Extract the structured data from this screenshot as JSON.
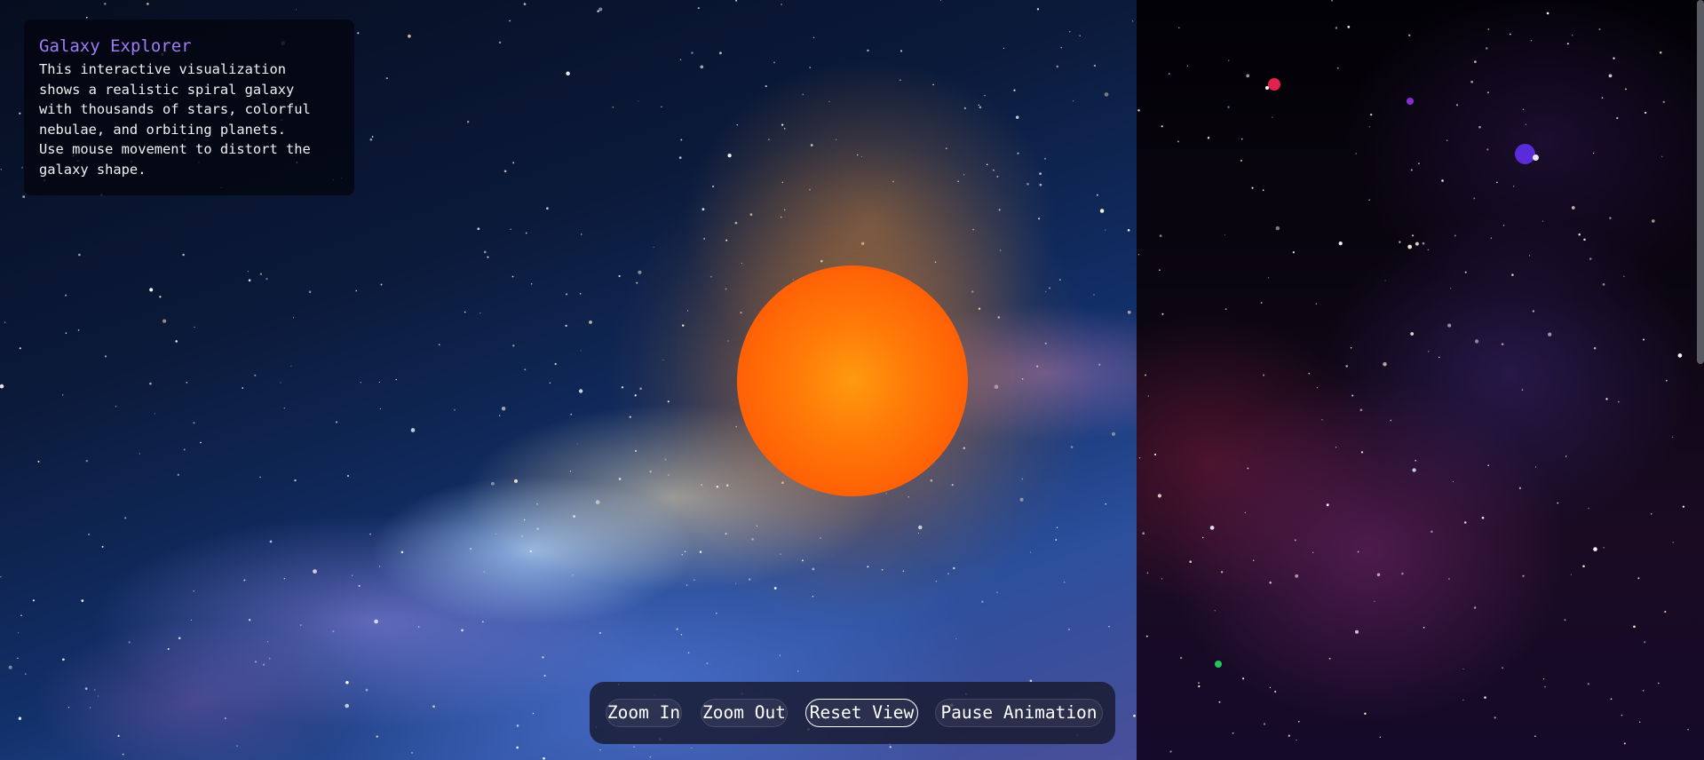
{
  "info": {
    "title": "Galaxy Explorer",
    "description": "This interactive visualization\nshows a realistic spiral galaxy\nwith thousands of stars, colorful\nnebulae, and orbiting planets.\nUse mouse movement to distort the\ngalaxy shape."
  },
  "controls": {
    "zoom_in_label": "Zoom In",
    "zoom_out_label": "Zoom Out",
    "reset_label": "Reset View",
    "pause_label": "Pause Animation"
  },
  "colors": {
    "title_accent": "#a07cf4",
    "sun": "#ff6a06",
    "planet_red": "#e2214d",
    "planet_purple": "#8b2bd4",
    "planet_violet": "#5a2bd8",
    "planet_green": "#22c55e"
  }
}
